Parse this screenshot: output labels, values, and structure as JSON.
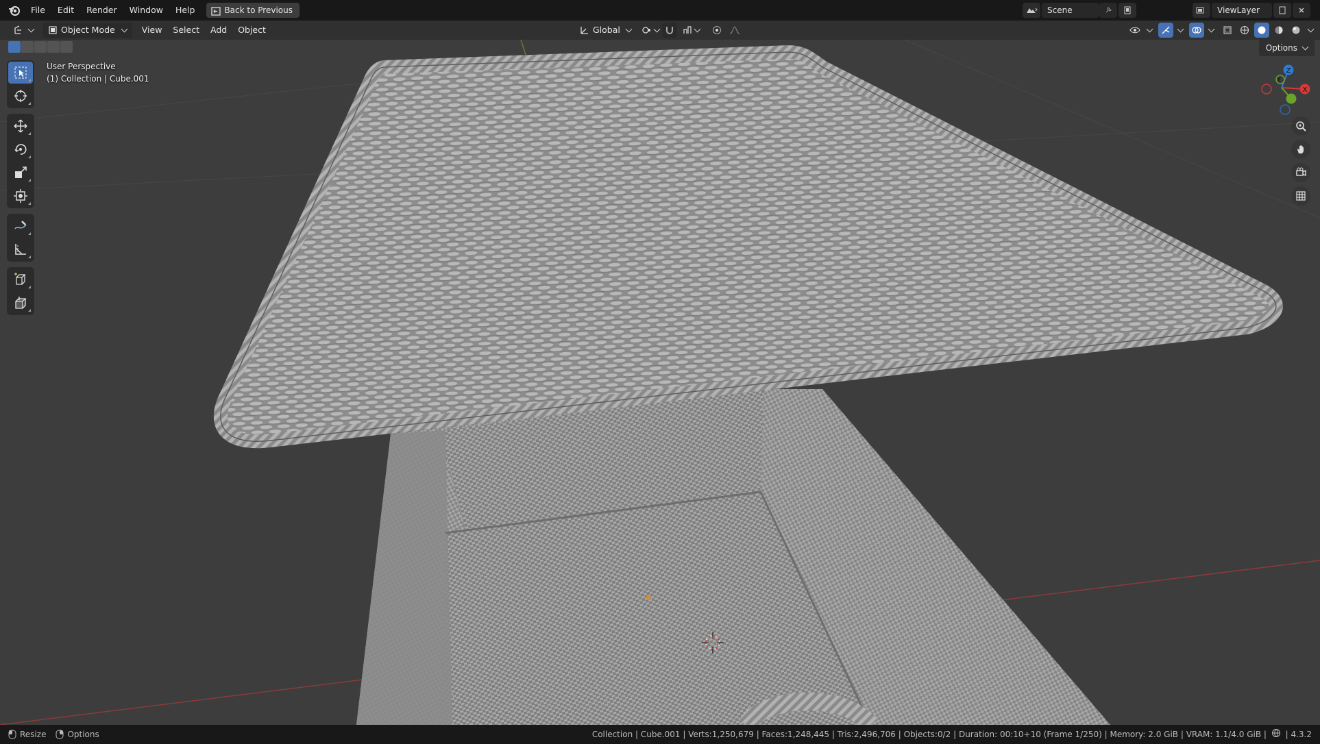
{
  "menubar": {
    "items": [
      "File",
      "Edit",
      "Render",
      "Window",
      "Help"
    ],
    "back_button": "Back to Previous",
    "scene_name": "Scene",
    "view_layer_name": "ViewLayer"
  },
  "viewport_header": {
    "mode": "Object Mode",
    "menus": [
      "View",
      "Select",
      "Add",
      "Object"
    ],
    "transform_orientation": "Global",
    "options_label": "Options"
  },
  "viewport": {
    "perspective_label": "User Perspective",
    "collection_label": "(1) Collection | Cube.001",
    "background_color": "#3d3d3d",
    "mesh_color": "#9a9a9a"
  },
  "gizmo": {
    "x_label": "X",
    "y_label": "Y",
    "z_label": "Z"
  },
  "toolbar": {
    "tools": [
      "select-box",
      "cursor",
      "move",
      "rotate",
      "scale",
      "transform",
      "annotate",
      "measure",
      "add-cube",
      "extrude"
    ]
  },
  "statusbar": {
    "left": [
      "Resize",
      "Options"
    ],
    "stats": "Collection | Cube.001 | Verts:1,250,679 | Faces:1,248,445 | Tris:2,496,706 | Objects:0/2 | Duration: 00:10+10 (Frame 1/250) | Memory: 2.0 GiB | VRAM: 1.1/4.0 GiB |",
    "version": "4.3.2"
  }
}
